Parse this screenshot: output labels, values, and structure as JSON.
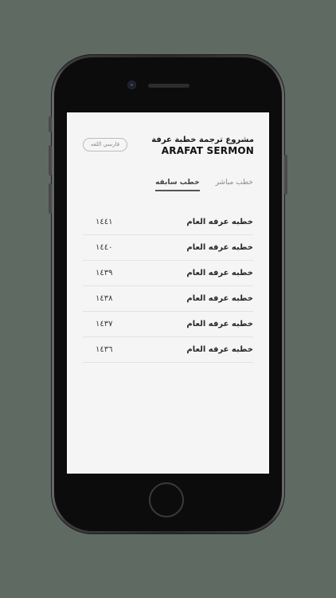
{
  "header": {
    "language_button": "فارسي اللغه",
    "title_ar": "مشروع ترجمة خطبة عرفة",
    "title_en": "ARAFAT SERMON"
  },
  "tabs": [
    {
      "label": "خطب مباشر",
      "active": false
    },
    {
      "label": "خطب سابقه",
      "active": true
    }
  ],
  "sermons": [
    {
      "title": "خطبه عرفه العام",
      "year": "١٤٤١"
    },
    {
      "title": "خطبه عرفه العام",
      "year": "١٤٤٠"
    },
    {
      "title": "خطبه عرفه العام",
      "year": "١٤٣٩"
    },
    {
      "title": "خطبه عرفه العام",
      "year": "١٤٣٨"
    },
    {
      "title": "خطبه عرفه العام",
      "year": "١٤٣٧"
    },
    {
      "title": "خطبه عرفه العام",
      "year": "١٤٣٦"
    }
  ],
  "colors": {
    "background": "#5f6a63",
    "screen": "#f5f5f5",
    "phone_frame": "#2a2a2c"
  }
}
